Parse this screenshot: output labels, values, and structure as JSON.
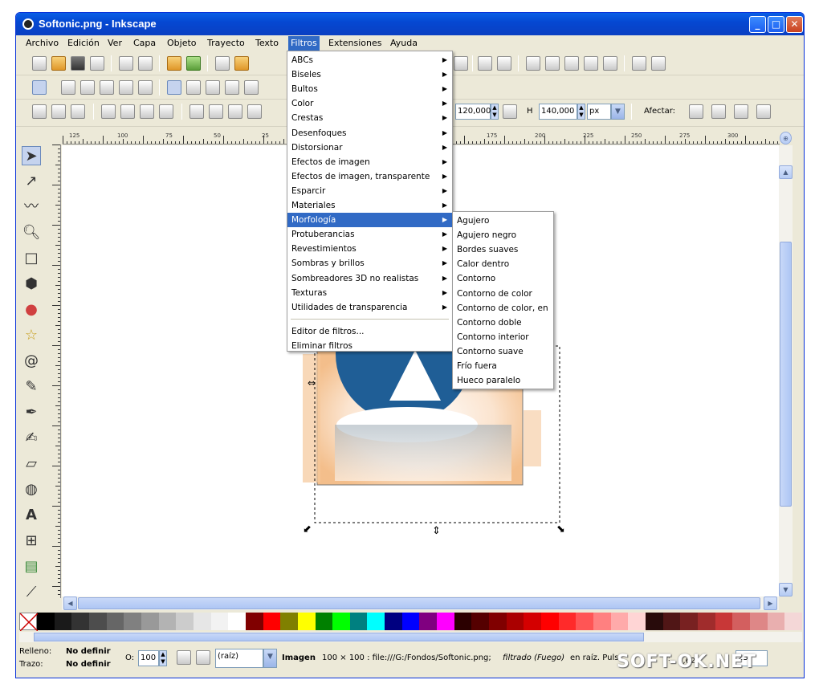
{
  "window": {
    "title": "Softonic.png - Inkscape",
    "buttons": {
      "minimize": "_",
      "maximize": "□",
      "close": "✕"
    }
  },
  "menubar": [
    {
      "label": "Archivo"
    },
    {
      "label": "Edición"
    },
    {
      "label": "Ver"
    },
    {
      "label": "Capa"
    },
    {
      "label": "Objeto"
    },
    {
      "label": "Trayecto"
    },
    {
      "label": "Texto"
    },
    {
      "label": "Filtros",
      "active": true
    },
    {
      "label": "Extensiones"
    },
    {
      "label": "Ayuda"
    }
  ],
  "toolbar3": {
    "w_value": "120,000",
    "h_label": "H",
    "h_value": "140,000",
    "unit": "px",
    "afectar_label": "Afectar:"
  },
  "ruler_labels": [
    "125",
    "100",
    "75",
    "50",
    "25",
    "175",
    "200",
    "225",
    "250",
    "275",
    "300"
  ],
  "filters_menu": {
    "items": [
      {
        "label": "ABCs",
        "submenu": true
      },
      {
        "label": "Biseles",
        "submenu": true
      },
      {
        "label": "Bultos",
        "submenu": true
      },
      {
        "label": "Color",
        "submenu": true
      },
      {
        "label": "Crestas",
        "submenu": true
      },
      {
        "label": "Desenfoques",
        "submenu": true
      },
      {
        "label": "Distorsionar",
        "submenu": true
      },
      {
        "label": "Efectos de imagen",
        "submenu": true
      },
      {
        "label": "Efectos de imagen, transparente",
        "submenu": true
      },
      {
        "label": "Esparcir",
        "submenu": true
      },
      {
        "label": "Materiales",
        "submenu": true
      },
      {
        "label": "Morfología",
        "submenu": true,
        "highlighted": true
      },
      {
        "label": "Protuberancias",
        "submenu": true
      },
      {
        "label": "Revestimientos",
        "submenu": true
      },
      {
        "label": "Sombras y brillos",
        "submenu": true
      },
      {
        "label": "Sombreadores 3D no realistas",
        "submenu": true
      },
      {
        "label": "Texturas",
        "submenu": true
      },
      {
        "label": "Utilidades de transparencia",
        "submenu": true
      }
    ],
    "footer_items": [
      {
        "label": "Editor de filtros..."
      },
      {
        "label": "Eliminar filtros"
      }
    ]
  },
  "morphology_submenu": [
    "Agujero",
    "Agujero negro",
    "Bordes suaves",
    "Calor dentro",
    "Contorno",
    "Contorno de color",
    "Contorno de color, en",
    "Contorno doble",
    "Contorno interior",
    "Contorno suave",
    "Frío fuera",
    "Hueco paralelo"
  ],
  "palette": [
    "#000000",
    "#1a1a1a",
    "#333333",
    "#4d4d4d",
    "#666666",
    "#808080",
    "#999999",
    "#b3b3b3",
    "#cccccc",
    "#e6e6e6",
    "#f2f2f2",
    "#ffffff",
    "#800000",
    "#ff0000",
    "#808000",
    "#ffff00",
    "#008000",
    "#00ff00",
    "#008080",
    "#00ffff",
    "#000080",
    "#0000ff",
    "#800080",
    "#ff00ff",
    "#2b0000",
    "#550000",
    "#800000",
    "#aa0000",
    "#d40000",
    "#ff0000",
    "#ff2a2a",
    "#ff5555",
    "#ff8080",
    "#ffaaaa",
    "#ffd5d5",
    "#280b0b",
    "#501616",
    "#782121",
    "#a02c2c",
    "#c83737",
    "#d35f5f",
    "#de8787",
    "#e9afaf",
    "#f4d7d7"
  ],
  "statusbar": {
    "fill_label": "Relleno:",
    "fill_value": "No definir",
    "stroke_label": "Trazo:",
    "stroke_value": "No definir",
    "opacity_label": "O:",
    "opacity_value": "100",
    "layer_value": "(raíz)",
    "message_bold": "Imagen",
    "message": "100 × 100 : file:///G:/Fondos/Softonic.png;",
    "message_italic": "filtrado (Fuego)",
    "message_tail": "en raíz. Puls",
    "coord_y_label": "Y:",
    "coord_y": "6,62",
    "zoom": "23"
  },
  "watermark": "SOFT-OK.NET",
  "icons": {
    "window": "inkscape-icon",
    "tools": [
      "selector-icon",
      "node-icon",
      "tweak-icon",
      "zoom-icon",
      "rect-icon",
      "3dbox-icon",
      "ellipse-icon",
      "star-icon",
      "spiral-icon",
      "pencil-icon",
      "pen-icon",
      "calligraphy-icon",
      "eraser-icon",
      "paint-bucket-icon",
      "text-icon",
      "connector-icon",
      "gradient-icon",
      "dropper-icon"
    ]
  }
}
